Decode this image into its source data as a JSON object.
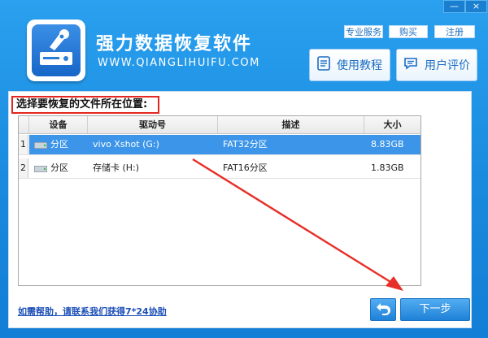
{
  "window": {
    "minimize_label": "—",
    "close_label": "×"
  },
  "header": {
    "title": "强力数据恢复软件",
    "subtitle": "WWW.QIANGLIHUIFU.COM",
    "links": {
      "pro_service": "专业服务",
      "buy": "购买",
      "register": "注册"
    },
    "tutorial_label": "使用教程",
    "review_label": "用户评价"
  },
  "main": {
    "prompt": "选择要恢复的文件所在位置:",
    "table": {
      "columns": [
        "设备",
        "驱动号",
        "描述",
        "大小"
      ],
      "rows": [
        {
          "index": "1",
          "device": "分区",
          "drive": "vivo Xshot (G:)",
          "desc": "FAT32分区",
          "size": "8.83GB",
          "selected": true
        },
        {
          "index": "2",
          "device": "分区",
          "drive": "存储卡 (H:)",
          "desc": "FAT16分区",
          "size": "1.83GB",
          "selected": false
        }
      ]
    }
  },
  "footer": {
    "help_text": "如需帮助，请联系我们获得7*24协助",
    "next_label": "下一步"
  },
  "colors": {
    "accent": "#1e8fe0",
    "highlight": "#e5261f",
    "selected_row": "#3c95e8"
  }
}
